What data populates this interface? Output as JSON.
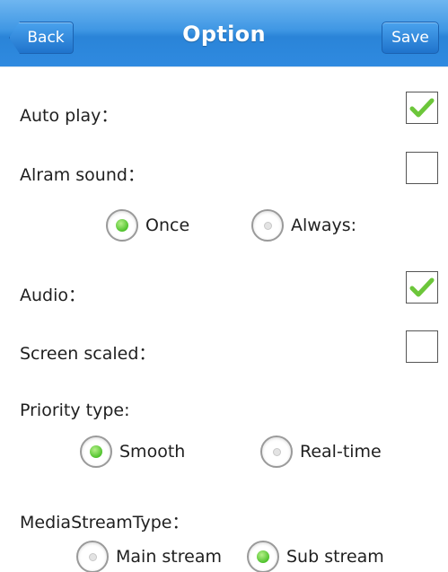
{
  "header": {
    "title": "Option",
    "back_label": "Back",
    "save_label": "Save"
  },
  "options": {
    "auto_play": {
      "label": "Auto play：",
      "checked": true
    },
    "alarm_sound": {
      "label": "Alram sound：",
      "checked": false,
      "radios": [
        {
          "label": "Once",
          "selected": true
        },
        {
          "label": "Always:",
          "selected": false
        }
      ]
    },
    "audio": {
      "label": "Audio：",
      "checked": true
    },
    "screen_scaled": {
      "label": "Screen scaled：",
      "checked": false
    },
    "priority_type": {
      "label": "Priority type:",
      "radios": [
        {
          "label": "Smooth",
          "selected": true
        },
        {
          "label": "Real-time",
          "selected": false
        }
      ]
    },
    "media_stream_type": {
      "label": "MediaStreamType：",
      "radios": [
        {
          "label": "Main stream",
          "selected": false
        },
        {
          "label": "Sub stream",
          "selected": true
        }
      ]
    }
  },
  "colors": {
    "header_blue": "#3f97e4",
    "check_green": "#6cc63a",
    "radio_green": "#4fc22c"
  }
}
